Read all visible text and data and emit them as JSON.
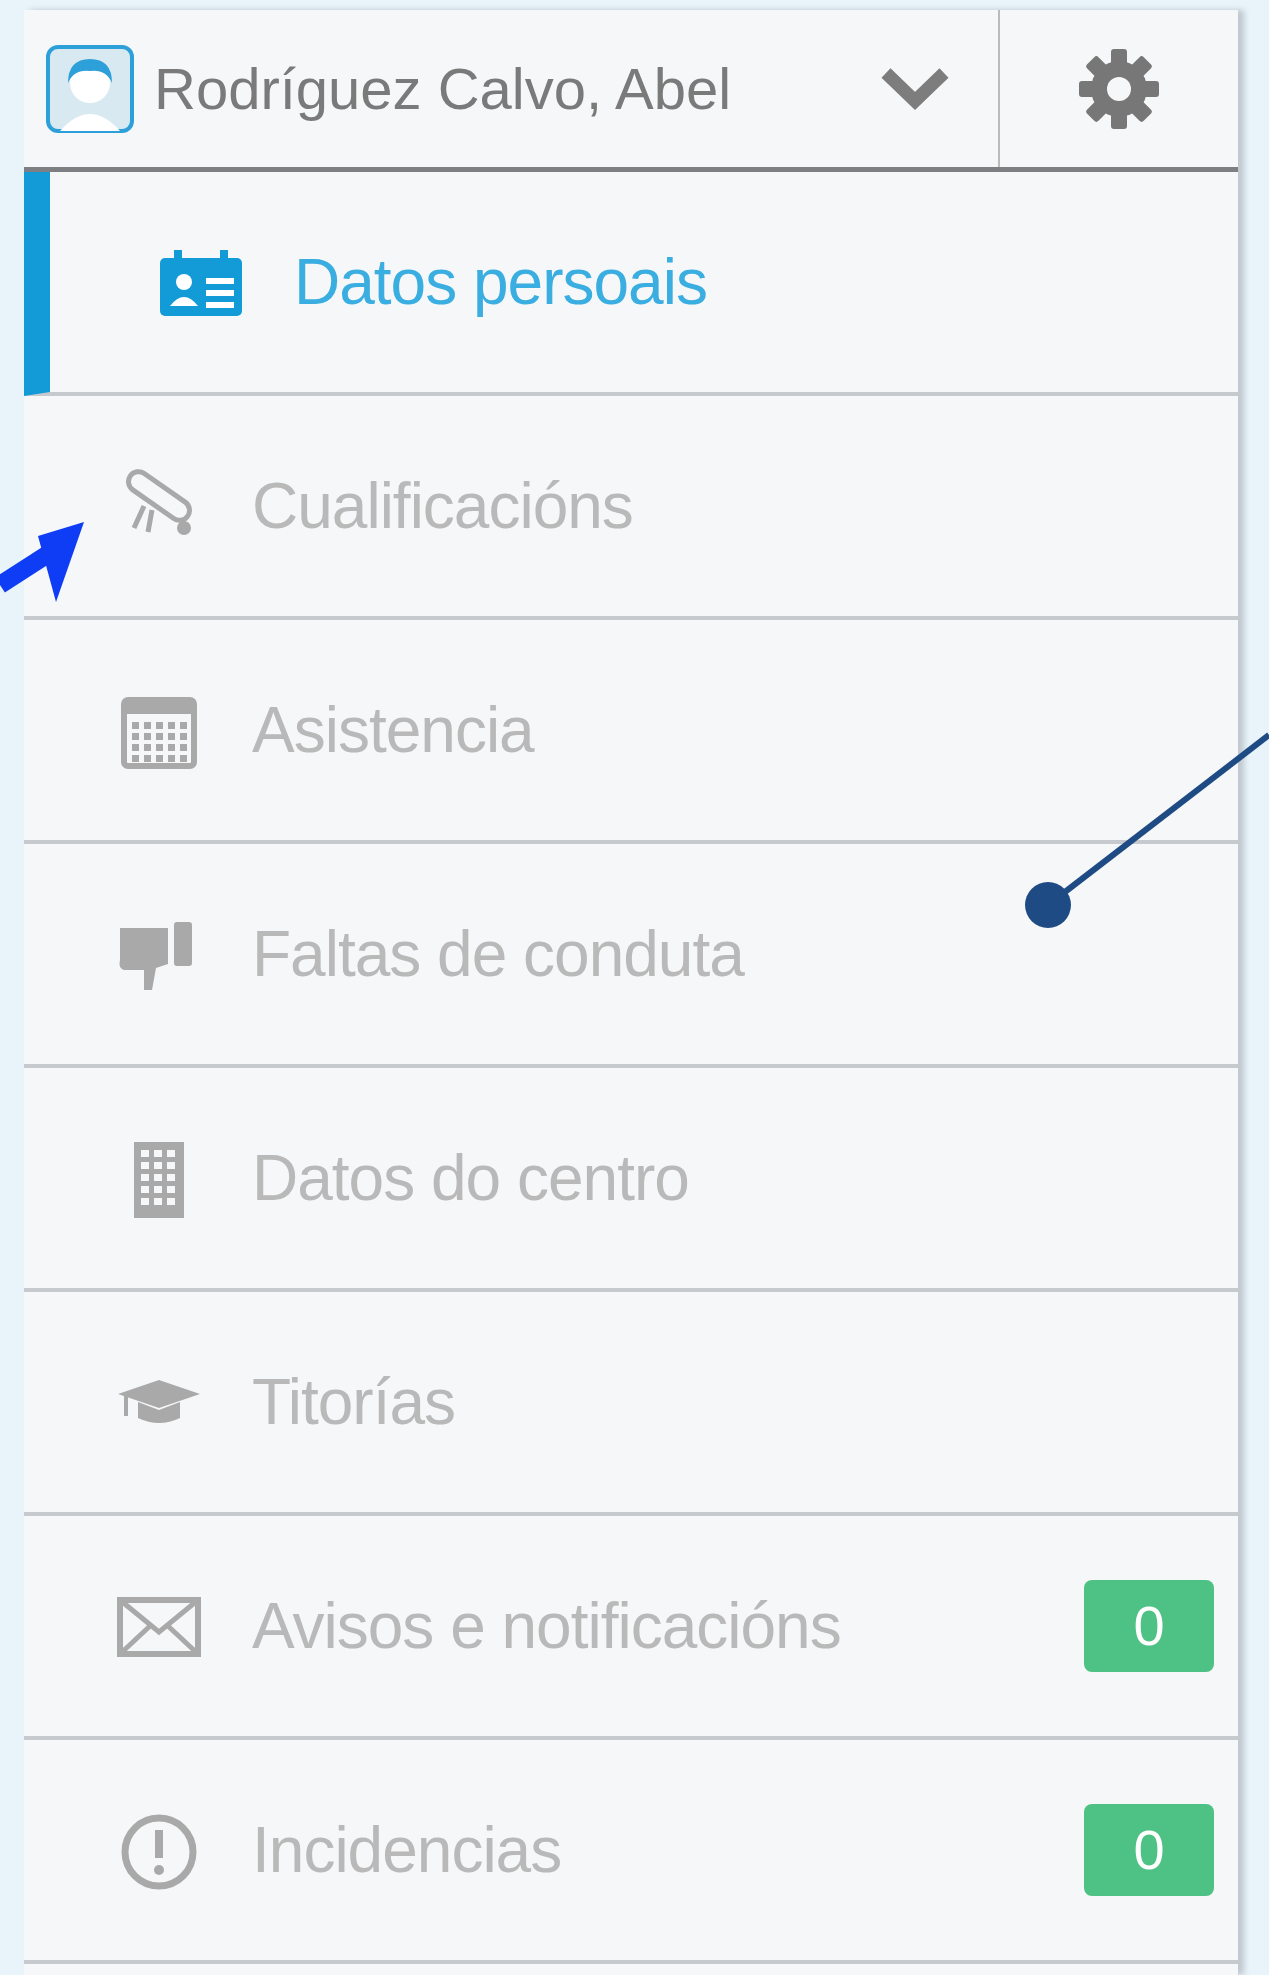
{
  "header": {
    "user_name": "Rodríguez Calvo, Abel"
  },
  "menu": [
    {
      "label": "Datos persoais",
      "selected": true
    },
    {
      "label": "Cualificacións",
      "selected": false
    },
    {
      "label": "Asistencia",
      "selected": false
    },
    {
      "label": "Faltas de conduta",
      "selected": false
    },
    {
      "label": "Datos do centro",
      "selected": false
    },
    {
      "label": "Titorías",
      "selected": false
    },
    {
      "label": "Avisos e notificacións",
      "selected": false,
      "badge": "0"
    },
    {
      "label": "Incidencias",
      "selected": false,
      "badge": "0"
    }
  ]
}
